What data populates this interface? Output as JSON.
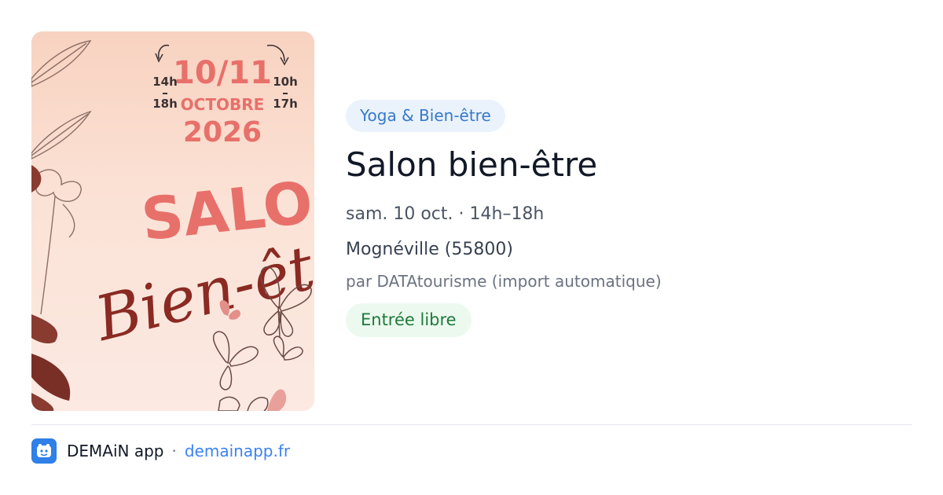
{
  "poster": {
    "days": "10/11",
    "month": "OCTOBRE",
    "year": "2026",
    "left_hours": {
      "start": "14h",
      "end": "18h"
    },
    "right_hours": {
      "start": "10h",
      "end": "17h"
    },
    "word1": "SALO",
    "word2": "Bien-êt",
    "colors": {
      "salmon": "#e8706a",
      "burgundy": "#8a2a22",
      "sketch": "#8c6f66"
    }
  },
  "event": {
    "category": "Yoga & Bien-être",
    "title": "Salon bien-être",
    "date": "sam. 10 oct. · 14h–18h",
    "place": "Mognéville (55800)",
    "source": "par DATAtourisme (import automatique)",
    "price": "Entrée libre"
  },
  "footer": {
    "app_name": "DEMAiN app",
    "separator": "·",
    "link": "demainapp.fr",
    "icon": "demain-app-icon"
  },
  "colors": {
    "category_bg": "#eaf2fc",
    "category_text": "#3779c8",
    "price_bg": "#ecf9ef",
    "price_text": "#1f7a3b",
    "link": "#3b82f6"
  }
}
